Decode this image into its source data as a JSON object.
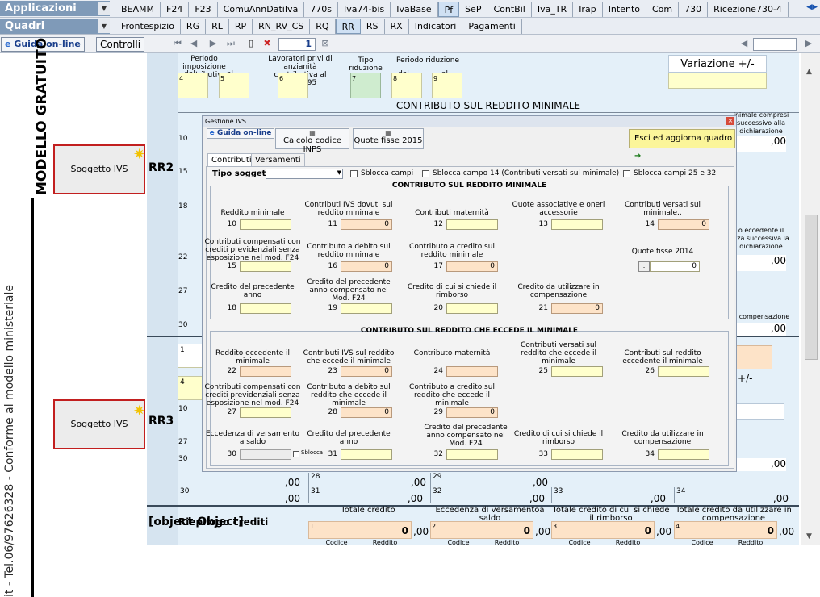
{
  "menus": {
    "applicazioni": "Applicazioni",
    "quadri": "Quadri"
  },
  "tabs_row1": [
    "BEAMM",
    "F24",
    "F23",
    "ComuAnnDatiIva",
    "770s",
    "Iva74-bis",
    "IvaBase",
    "Pf",
    "SeP",
    "ContBil",
    "Iva_TR",
    "Irap",
    "Intento",
    "Com",
    "730",
    "Ricezione730-4"
  ],
  "tabs_row2": [
    "Frontespizio",
    "RG",
    "RL",
    "RP",
    "RN_RV_CS",
    "RQ",
    "RR",
    "RS",
    "RX",
    "Indicatori",
    "Pagamenti"
  ],
  "toolbar": {
    "guida": "Guida on-line",
    "controlli": "Controlli",
    "page": "1"
  },
  "gutter": {
    "vertical_title": "MODELLO GRATUITO",
    "vertical_sub": "it - Tel.06/97626328 - Conforme al modello ministeriale"
  },
  "form": {
    "header_labels": {
      "periodo_imp": "Periodo imposizione contributiva",
      "dal": "dal",
      "al": "al",
      "lavoratori": "Lavoratori privi di anzianità contributiva al 31/12/95",
      "tipo_rid": "Tipo riduzione",
      "periodo_rid": "Periodo riduzione",
      "dal2": "dal",
      "al2": "al",
      "variazione": "Variazione +/-"
    },
    "contributo_minimale": "CONTRIBUTO SUL REDDITO MINIMALE",
    "rr2": "RR2",
    "rr3": "RR3",
    "rr4": {
      "title": "Riepilogo crediti",
      "col1": "Totale credito",
      "col2": "Eccedenza di versamentoa saldo",
      "col3": "Totale credito di cui si chiede il rimborso",
      "col4": "Totale credito da utilizzare in compensazione",
      "vals": [
        "0",
        "0",
        "0",
        "0"
      ],
      "nums": [
        "1",
        "2",
        "3",
        "4"
      ],
      "codice": "Codice",
      "reddito": "Reddito"
    },
    "soggetto_ivs": "Soggetto IVS",
    "side_texts": {
      "t1": "inimale compresi successivo alla dichiarazione",
      "t2": "o eccedente il nza successiva la dichiarazione",
      "t3": "compensazione",
      "t4": "+/-"
    },
    "row_nums_left": [
      "4",
      "5",
      "6",
      "7",
      "8",
      "9",
      "10",
      "15",
      "18",
      "22",
      "27",
      "30",
      "1",
      "4",
      "10",
      "27",
      "30"
    ],
    "zero": ",00",
    "bottom_fields": [
      "27",
      "28",
      "29",
      "30",
      "31",
      "32",
      "33",
      "34"
    ]
  },
  "dialog": {
    "title": "Gestione IVS",
    "guida": "Guida on-line",
    "calcolo": "Calcolo codice INPS",
    "quote": "Quote fisse 2015",
    "esci": "Esci ed aggiorna quadro",
    "tab_contributi": "Contributi",
    "tab_versamenti": "Versamenti",
    "tipo_soggetto": "Tipo soggetto",
    "sblocca_campi": "Sblocca campi",
    "sblocca_14": "Sblocca campo 14 (Contributi versati sul minimale)",
    "sblocca_25": "Sblocca campi 25 e 32",
    "group1_title": "CONTRIBUTO SUL REDDITO MINIMALE",
    "group2_title": "CONTRIBUTO SUL REDDITO CHE ECCEDE IL MINIMALE",
    "g1": [
      {
        "n": "10",
        "l": "Reddito minimale",
        "v": "",
        "t": "y"
      },
      {
        "n": "11",
        "l": "Contributi IVS dovuti sul reddito minimale",
        "v": "0",
        "t": "p"
      },
      {
        "n": "12",
        "l": "Contributi maternità",
        "v": "",
        "t": "y"
      },
      {
        "n": "13",
        "l": "Quote associative e oneri accessorie",
        "v": "",
        "t": "y"
      },
      {
        "n": "14",
        "l": "Contributi versati sul minimale..",
        "v": "0",
        "t": "p"
      },
      {
        "n": "15",
        "l": "Contributi compensati con crediti previdenziali senza esposizione nel mod. F24",
        "v": "",
        "t": "y"
      },
      {
        "n": "16",
        "l": "Contributo a debito sul reddito minimale",
        "v": "0",
        "t": "p"
      },
      {
        "n": "17",
        "l": "Contributo a credito sul reddito minimale",
        "v": "0",
        "t": "p"
      },
      {
        "n": "",
        "l": "Quote fisse 2014",
        "v": "0",
        "t": "q"
      },
      {
        "n": "18",
        "l": "Credito del precedente anno",
        "v": "",
        "t": "y"
      },
      {
        "n": "19",
        "l": "Credito del precedente anno compensato nel Mod. F24",
        "v": "",
        "t": "y"
      },
      {
        "n": "20",
        "l": "Credito di cui si chiede il rimborso",
        "v": "",
        "t": "y"
      },
      {
        "n": "21",
        "l": "Credito da utilizzare in compensazione",
        "v": "0",
        "t": "p"
      }
    ],
    "g2": [
      {
        "n": "22",
        "l": "Reddito eccedente il minimale",
        "v": "",
        "t": "p"
      },
      {
        "n": "23",
        "l": "Contributi IVS sul reddito che eccede il minimale",
        "v": "0",
        "t": "p"
      },
      {
        "n": "24",
        "l": "Contributo maternità",
        "v": "",
        "t": "p"
      },
      {
        "n": "25",
        "l": "Contributi versati sul reddito che eccede il minimale",
        "v": "",
        "t": "y"
      },
      {
        "n": "26",
        "l": "Contributi sul reddito eccedente il minimale",
        "v": "",
        "t": "y"
      },
      {
        "n": "27",
        "l": "Contributi compensati con crediti previdenziali senza esposizione nel mod. F24",
        "v": "",
        "t": "y"
      },
      {
        "n": "28",
        "l": "Contributo a debito sul reddito che eccede il minimale",
        "v": "0",
        "t": "p"
      },
      {
        "n": "29",
        "l": "Contributo a credito sul reddito che eccede il minimale",
        "v": "0",
        "t": "p"
      },
      {
        "n": "30",
        "l": "Eccedenza di versamento a saldo",
        "v": "",
        "t": "g"
      },
      {
        "n": "31",
        "l": "Credito del precedente anno",
        "v": "",
        "t": "y"
      },
      {
        "n": "32",
        "l": "Credito del precedente anno compensato nel Mod. F24",
        "v": "",
        "t": "y"
      },
      {
        "n": "33",
        "l": "Credito di cui si chiede il rimborso",
        "v": "",
        "t": "y"
      },
      {
        "n": "34",
        "l": "Credito da utilizzare in compensazione",
        "v": "",
        "t": "y"
      }
    ],
    "sblocca": "Sblocca"
  }
}
